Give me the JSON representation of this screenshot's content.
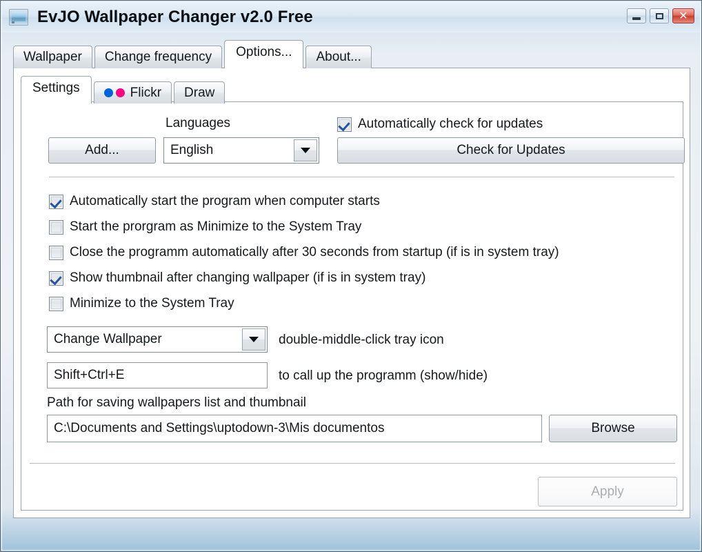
{
  "window": {
    "title": "EvJO Wallpaper Changer v2.0 Free",
    "icon": "wallpaper-monitor-icon",
    "controls": {
      "minimize_label": "–",
      "maximize_label": "□",
      "close_label": "✕"
    },
    "frame_color": "#5e6d78",
    "titlebar_gradient_top": "#e9f1f8",
    "titlebar_gradient_bottom": "#cfe0ee"
  },
  "outer_tabs": [
    {
      "label": "Wallpaper",
      "active": false
    },
    {
      "label": "Change frequency",
      "active": false
    },
    {
      "label": "Options...",
      "active": true
    },
    {
      "label": "About...",
      "active": false
    }
  ],
  "inner_tabs": [
    {
      "label": "Settings",
      "active": true,
      "icon": null
    },
    {
      "label": "Flickr",
      "active": false,
      "icon": "flickr-dots-icon"
    },
    {
      "label": "Draw",
      "active": false,
      "icon": null
    }
  ],
  "flickr_colors": {
    "blue": "#0063dc",
    "pink": "#ff0084"
  },
  "settings": {
    "languages_label": "Languages",
    "add_button": "Add...",
    "language_selected": "English",
    "auto_update_checkbox": {
      "label": "Automatically check for updates",
      "checked": true
    },
    "check_updates_button": "Check for Updates",
    "options": [
      {
        "label": "Automatically start the program when computer starts",
        "checked": true
      },
      {
        "label": "Start the prorgram as Minimize to the System Tray",
        "checked": false
      },
      {
        "label": "Close the programm automatically after 30 seconds from startup  (if is in system tray)",
        "checked": false
      },
      {
        "label": "Show thumbnail after changing wallpaper (if is in system tray)",
        "checked": true
      },
      {
        "label": "Minimize to the System Tray",
        "checked": false
      }
    ],
    "tray_action_selected": "Change Wallpaper",
    "tray_action_label": "double-middle-click tray icon",
    "hotkey_value": "Shift+Ctrl+E",
    "hotkey_label": "to call up the programm (show/hide)",
    "path_label": "Path for saving wallpapers list and thumbnail",
    "path_value": "C:\\Documents and Settings\\uptodown-3\\Mis documentos",
    "browse_button": "Browse",
    "apply_button": "Apply",
    "apply_disabled": true
  }
}
